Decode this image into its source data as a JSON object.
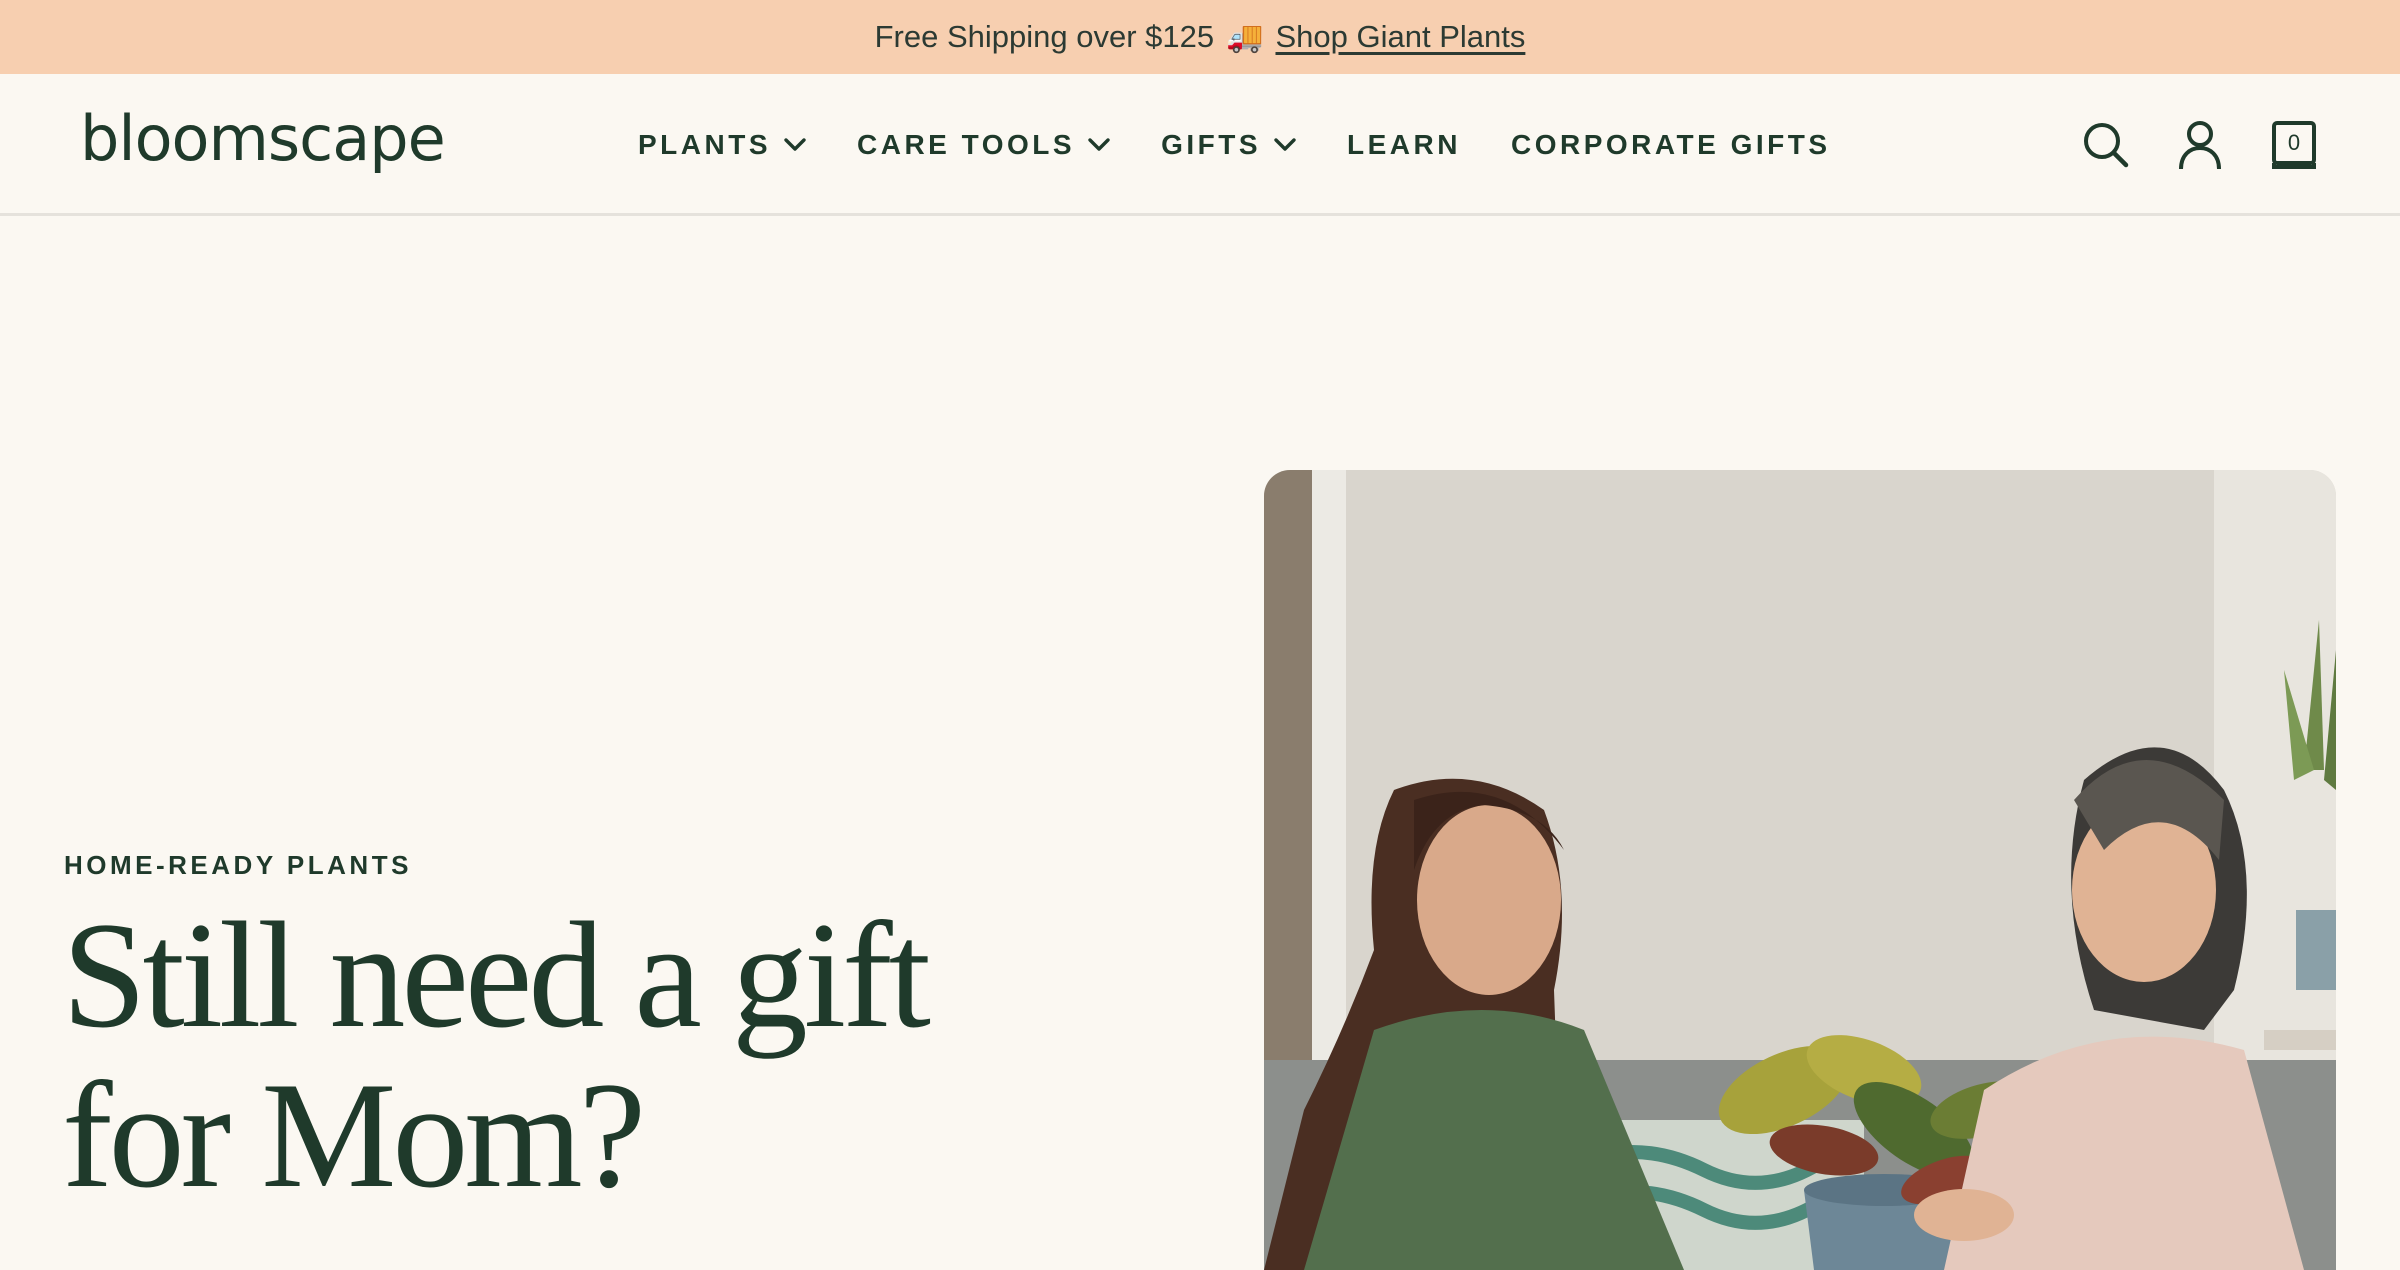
{
  "announcement": {
    "text": "Free Shipping over $125",
    "emoji": "🚚",
    "link_label": "Shop Giant Plants"
  },
  "header": {
    "logo": "bloomscape",
    "nav": [
      {
        "label": "PLANTS",
        "has_dropdown": true
      },
      {
        "label": "CARE TOOLS",
        "has_dropdown": true
      },
      {
        "label": "GIFTS",
        "has_dropdown": true
      },
      {
        "label": "LEARN",
        "has_dropdown": false
      },
      {
        "label": "CORPORATE GIFTS",
        "has_dropdown": false
      }
    ],
    "icons": [
      "search-icon",
      "account-icon",
      "cart-icon"
    ],
    "cart_count": "0"
  },
  "hero": {
    "eyebrow": "HOME-READY PLANTS",
    "headline_line1": "Still need a gift",
    "headline_line2": "for Mom?"
  },
  "colors": {
    "announcement_bg": "#f7cfb0",
    "page_bg": "#fbf8f2",
    "brand_green": "#1f3a2b"
  }
}
